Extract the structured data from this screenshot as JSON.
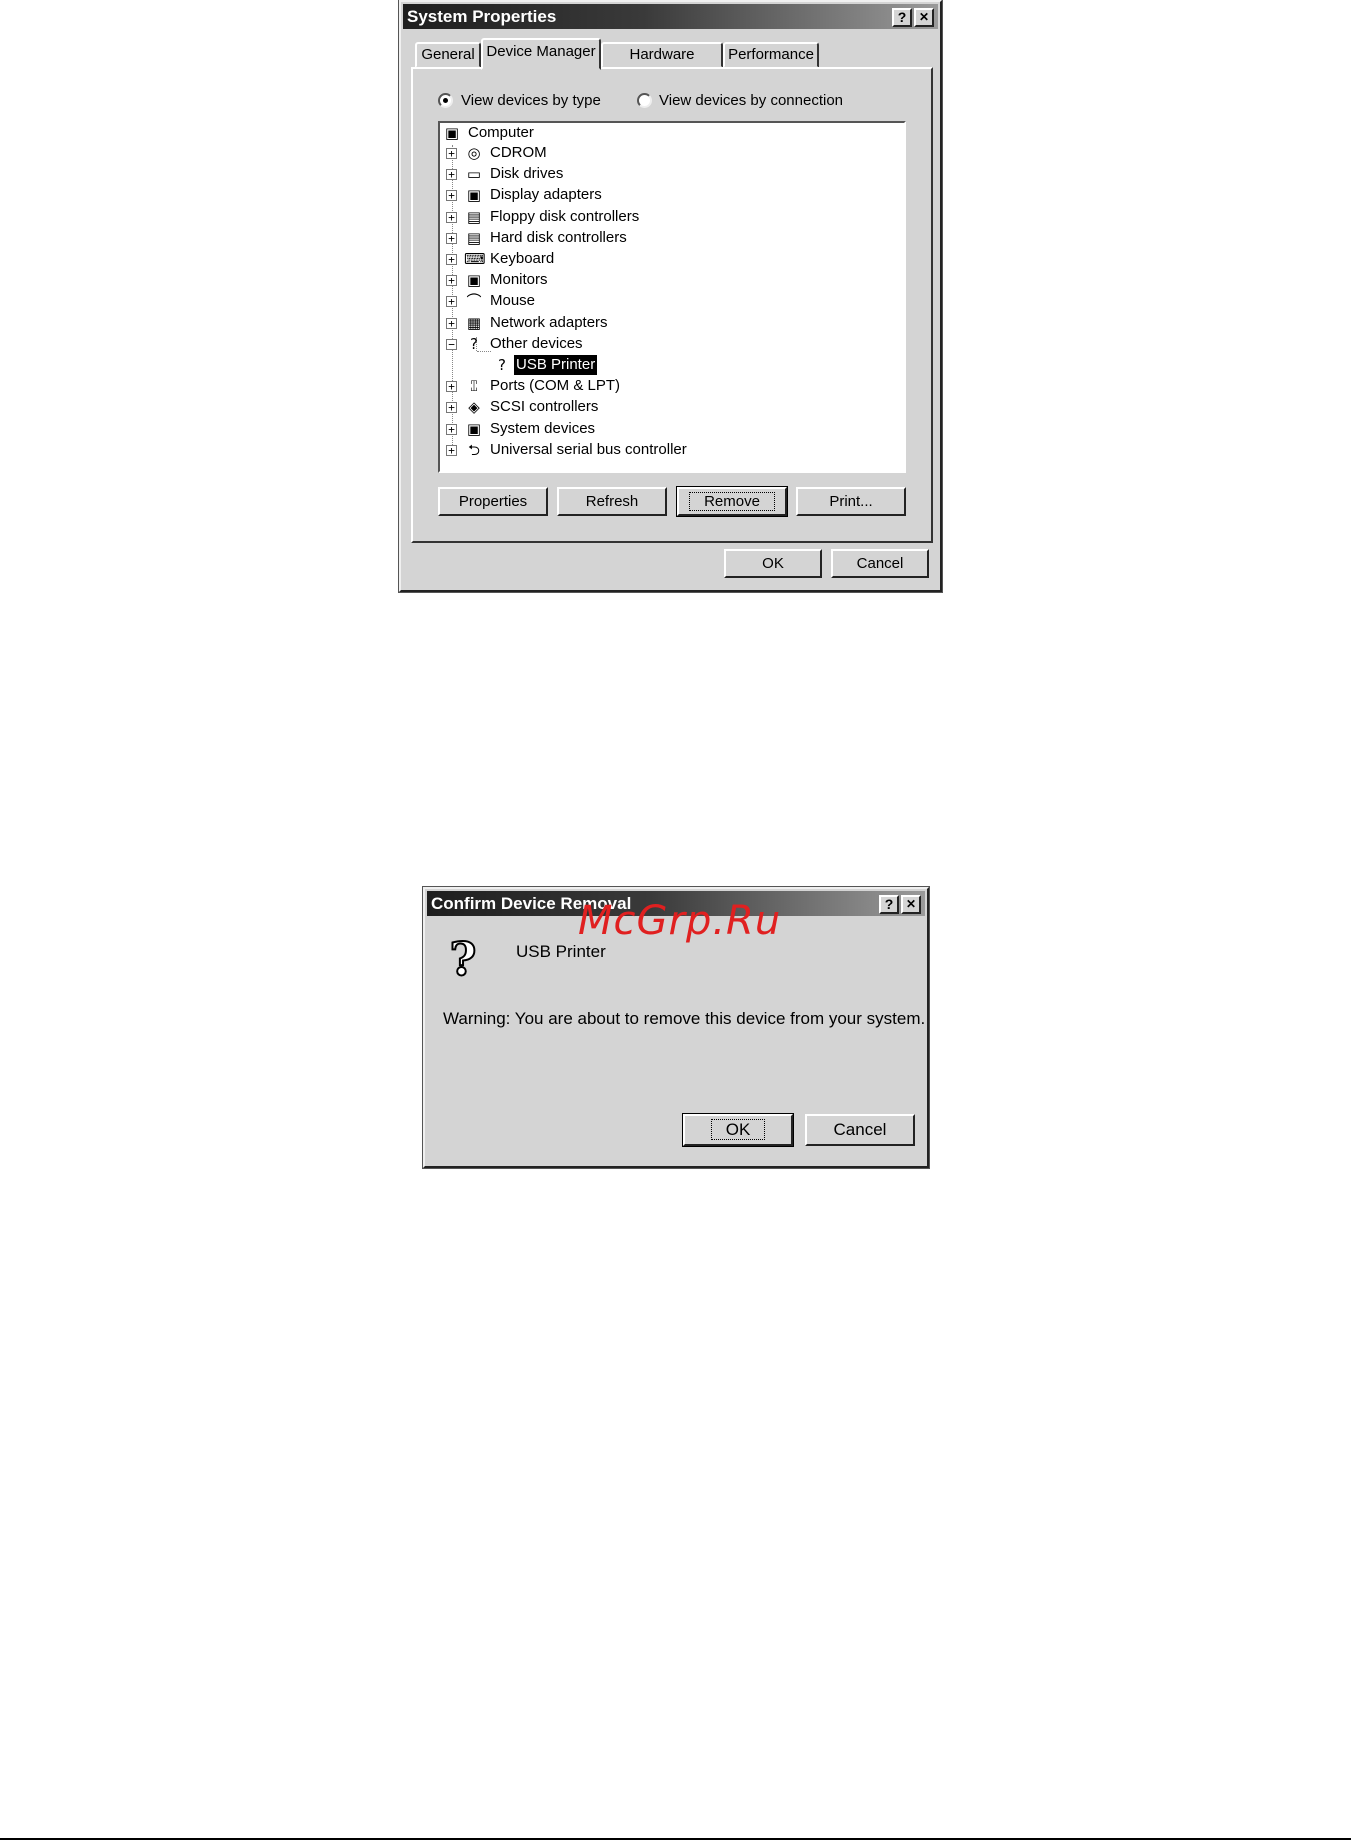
{
  "system_properties": {
    "title": "System Properties",
    "help_button": "?",
    "close_button": "✕",
    "tabs": [
      {
        "label": "General",
        "active": false
      },
      {
        "label": "Device Manager",
        "active": true
      },
      {
        "label": "Hardware Profiles",
        "active": false
      },
      {
        "label": "Performance",
        "active": false
      }
    ],
    "view_by_type": "View devices by type",
    "view_by_connection": "View devices by connection",
    "tree": {
      "root": "Computer",
      "items": [
        {
          "label": "CDROM",
          "icon": "cdrom-icon",
          "glyph": "◎",
          "expanded": false
        },
        {
          "label": "Disk drives",
          "icon": "disk-drive-icon",
          "glyph": "▭",
          "expanded": false
        },
        {
          "label": "Display adapters",
          "icon": "display-adapter-icon",
          "glyph": "▣",
          "expanded": false
        },
        {
          "label": "Floppy disk controllers",
          "icon": "floppy-controller-icon",
          "glyph": "▤",
          "expanded": false
        },
        {
          "label": "Hard disk controllers",
          "icon": "hard-disk-controller-icon",
          "glyph": "▤",
          "expanded": false
        },
        {
          "label": "Keyboard",
          "icon": "keyboard-icon",
          "glyph": "⌨",
          "expanded": false
        },
        {
          "label": "Monitors",
          "icon": "monitor-icon",
          "glyph": "▣",
          "expanded": false
        },
        {
          "label": "Mouse",
          "icon": "mouse-icon",
          "glyph": "⌒",
          "expanded": false
        },
        {
          "label": "Network adapters",
          "icon": "network-adapter-icon",
          "glyph": "▦",
          "expanded": false
        },
        {
          "label": "Other devices",
          "icon": "question-icon",
          "glyph": "?",
          "expanded": true
        },
        {
          "label": "USB Printer",
          "icon": "unknown-device-icon",
          "glyph": "?",
          "child": true,
          "selected": true
        },
        {
          "label": "Ports (COM & LPT)",
          "icon": "port-icon",
          "glyph": "⑄",
          "expanded": false
        },
        {
          "label": "SCSI controllers",
          "icon": "scsi-icon",
          "glyph": "◈",
          "expanded": false
        },
        {
          "label": "System devices",
          "icon": "system-device-icon",
          "glyph": "▣",
          "expanded": false
        },
        {
          "label": "Universal serial bus controller",
          "icon": "usb-icon",
          "glyph": "⮌",
          "expanded": false
        }
      ]
    },
    "buttons": {
      "properties": "Properties",
      "refresh": "Refresh",
      "remove": "Remove",
      "print": "Print...",
      "ok": "OK",
      "cancel": "Cancel"
    }
  },
  "confirm_removal": {
    "title": "Confirm Device Removal",
    "help_button": "?",
    "close_button": "✕",
    "device_name": "USB Printer",
    "warning": "Warning: You are about to remove this device from your system.",
    "ok": "OK",
    "cancel": "Cancel"
  },
  "watermark": "McGrp.Ru"
}
